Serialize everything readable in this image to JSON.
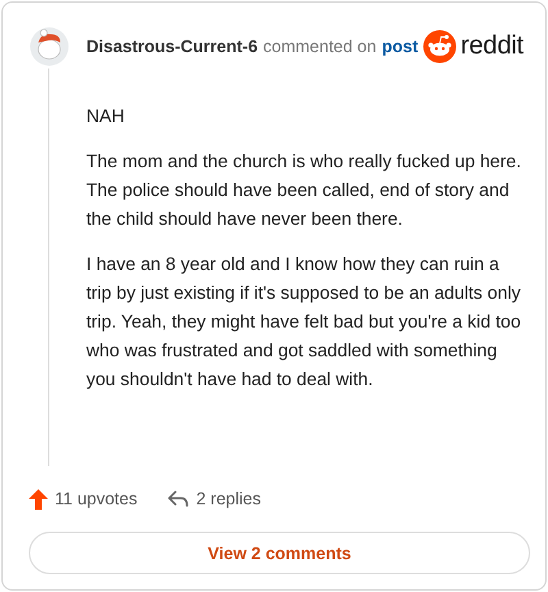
{
  "header": {
    "author": "Disastrous-Current-6",
    "action": "commented on",
    "link": "post",
    "brand": "reddit"
  },
  "body": [
    "NAH",
    "The mom and the church is who really fucked up here. The police should have been called, end of story and the child should have never been there.",
    "I have an 8 year old and I know how they can ruin a trip by just existing if it's supposed to be an adults only trip. Yeah, they might have felt bad but you're a kid too who was frustrated and got saddled with something you shouldn't have had to deal with."
  ],
  "footer": {
    "upvotes": "11 upvotes",
    "replies": "2 replies",
    "button": "View 2 comments"
  }
}
